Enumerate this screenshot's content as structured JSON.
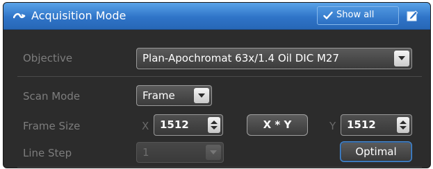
{
  "header": {
    "title": "Acquisition Mode",
    "show_all_label": "Show all",
    "accent": "#3a80d2"
  },
  "objective": {
    "label": "Objective",
    "value": "Plan-Apochromat 63x/1.4 Oil DIC M27"
  },
  "scan_mode": {
    "label": "Scan Mode",
    "value": "Frame"
  },
  "frame_size": {
    "label": "Frame Size",
    "x_label": "X",
    "x_value": "1512",
    "xy_button": "X * Y",
    "y_label": "Y",
    "y_value": "1512"
  },
  "line_step": {
    "label": "Line Step",
    "value": "1",
    "optimal_button": "Optimal"
  },
  "icons": [
    "collapse-icon",
    "check-icon",
    "edit-icon",
    "chevron-down-icon",
    "stepper-icon"
  ]
}
